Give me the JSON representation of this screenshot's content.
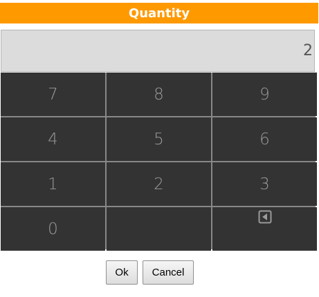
{
  "dialog": {
    "title": "Quantity",
    "display_value": "2"
  },
  "keypad": {
    "keys": [
      "7",
      "8",
      "9",
      "4",
      "5",
      "6",
      "1",
      "2",
      "3",
      "0",
      "",
      ""
    ],
    "backspace_icon": "backspace-icon"
  },
  "buttons": {
    "ok_label": "Ok",
    "cancel_label": "Cancel"
  },
  "colors": {
    "title_bar": "#ff9900",
    "key_background": "#333333",
    "key_text": "#9a9a9a",
    "display_background": "#dcdcdc"
  }
}
